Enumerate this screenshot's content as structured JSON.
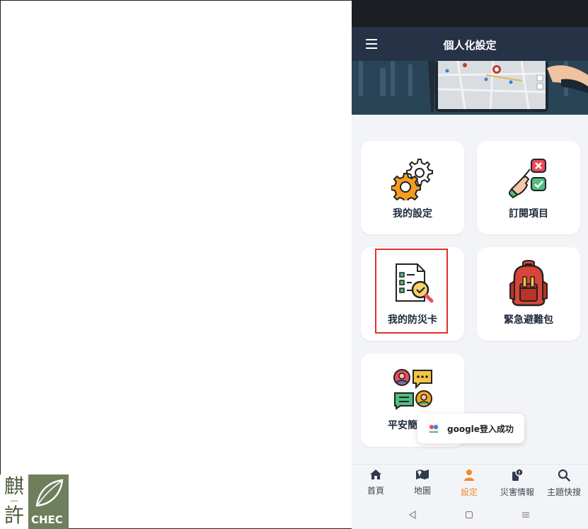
{
  "logo": {
    "char_top": "麒",
    "char_small": "──",
    "char_bottom": "許",
    "text": "CHEC"
  },
  "app_bar": {
    "title": "個人化設定",
    "menu_icon": "hamburger-icon"
  },
  "cards": [
    {
      "label": "我的設定",
      "icon": "gears-icon"
    },
    {
      "label": "訂閱項目",
      "icon": "subscribe-hand-icon"
    },
    {
      "label": "我的防災卡",
      "icon": "checklist-magnifier-icon"
    },
    {
      "label": "緊急避難包",
      "icon": "red-backpack-icon"
    },
    {
      "label": "平安簡",
      "icon": "chat-people-icon"
    }
  ],
  "toast": {
    "text": "google登入成功",
    "icon": "app-logo-icon"
  },
  "bottom_nav": [
    {
      "label": "首頁",
      "icon": "home-icon"
    },
    {
      "label": "地圖",
      "icon": "map-icon"
    },
    {
      "label": "設定",
      "icon": "person-icon",
      "active": true
    },
    {
      "label": "災害情報",
      "icon": "info-phone-icon"
    },
    {
      "label": "主題快搜",
      "icon": "search-icon"
    }
  ],
  "colors": {
    "app_bar": "#263246",
    "active_nav": "#f08a2c",
    "highlight": "#e0302a",
    "background": "#f3f4f7"
  }
}
